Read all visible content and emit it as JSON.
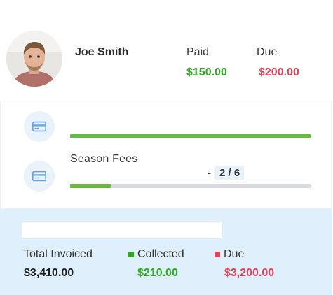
{
  "profile": {
    "name": "Joe Smith",
    "avatar_icon": "user-photo"
  },
  "header_stats": {
    "paid_label": "Paid",
    "paid_value": "$150.00",
    "due_label": "Due",
    "due_value": "$200.00"
  },
  "fees": [
    {
      "title": "",
      "count": "",
      "progress": 1.0,
      "icon": "credit-card-icon"
    },
    {
      "title": "Season Fees",
      "count": "2 / 6",
      "progress": 0.17,
      "icon": "credit-card-icon"
    }
  ],
  "summary": {
    "total_label": "Total Invoiced",
    "total_value": "$3,410.00",
    "collected_label": "Collected",
    "collected_value": "$210.00",
    "due_label": "Due",
    "due_value": "$3,200.00"
  },
  "colors": {
    "green": "#2eaa1f",
    "red": "#e0445a",
    "bar_green": "#6cb93f",
    "summary_bg": "#dff0fc"
  }
}
